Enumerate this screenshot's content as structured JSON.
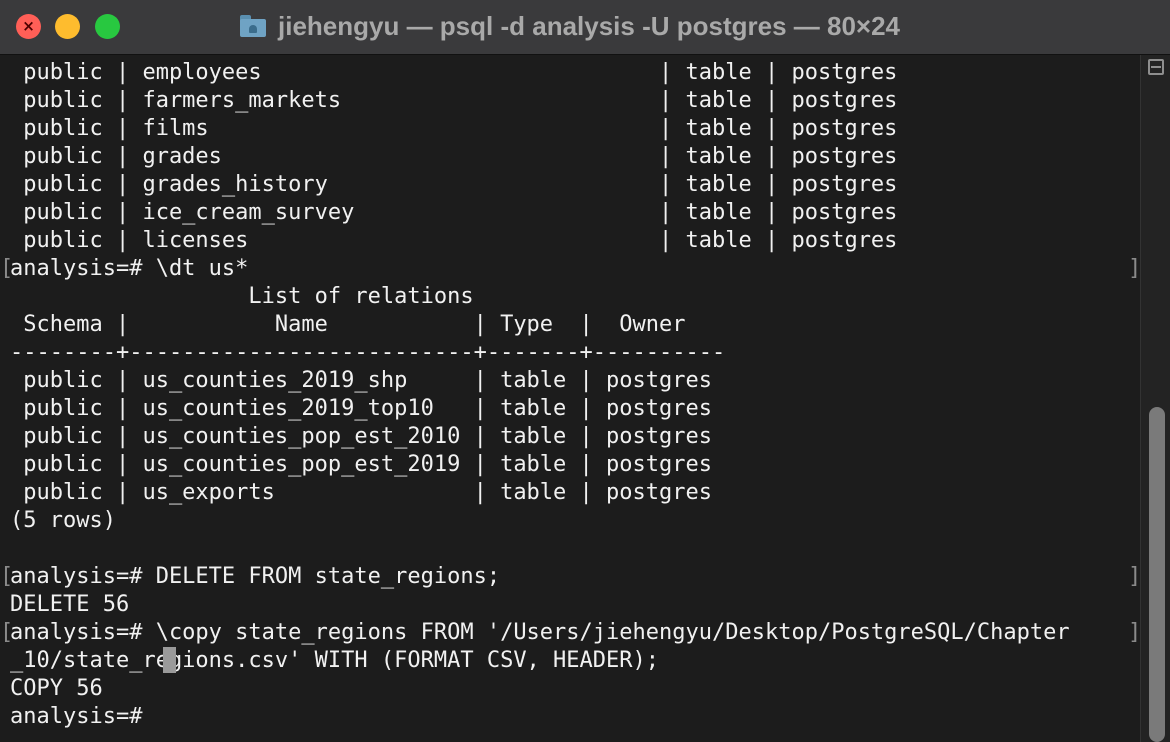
{
  "window": {
    "title": "jiehengyu — psql -d analysis -U postgres — 80×24",
    "close_symbol": "×"
  },
  "terminal": {
    "lines": [
      " public | employees                              | table | postgres",
      " public | farmers_markets                        | table | postgres",
      " public | films                                  | table | postgres",
      " public | grades                                 | table | postgres",
      " public | grades_history                         | table | postgres",
      " public | ice_cream_survey                       | table | postgres",
      " public | licenses                               | table | postgres",
      "analysis=# \\dt us*",
      "                  List of relations",
      " Schema |           Name           | Type  |  Owner",
      "--------+--------------------------+-------+----------",
      " public | us_counties_2019_shp     | table | postgres",
      " public | us_counties_2019_top10   | table | postgres",
      " public | us_counties_pop_est_2010 | table | postgres",
      " public | us_counties_pop_est_2019 | table | postgres",
      " public | us_exports               | table | postgres",
      "(5 rows)",
      "",
      "analysis=# DELETE FROM state_regions;",
      "DELETE 56",
      "analysis=# \\copy state_regions FROM '/Users/jiehengyu/Desktop/PostgreSQL/Chapter",
      "_10/state_regions.csv' WITH (FORMAT CSV, HEADER);",
      "COPY 56",
      "analysis=# "
    ],
    "mark_open": "[",
    "mark_close": "]"
  },
  "icons": {
    "title_folder": "folder-icon",
    "scroll_split": "split-view-icon"
  },
  "colors": {
    "titlebar": "#3a3a3c",
    "background": "#1c1c1c",
    "text": "#f1f1f1",
    "close": "#ff5f57",
    "minimize": "#febc2e",
    "maximize": "#28c840"
  }
}
